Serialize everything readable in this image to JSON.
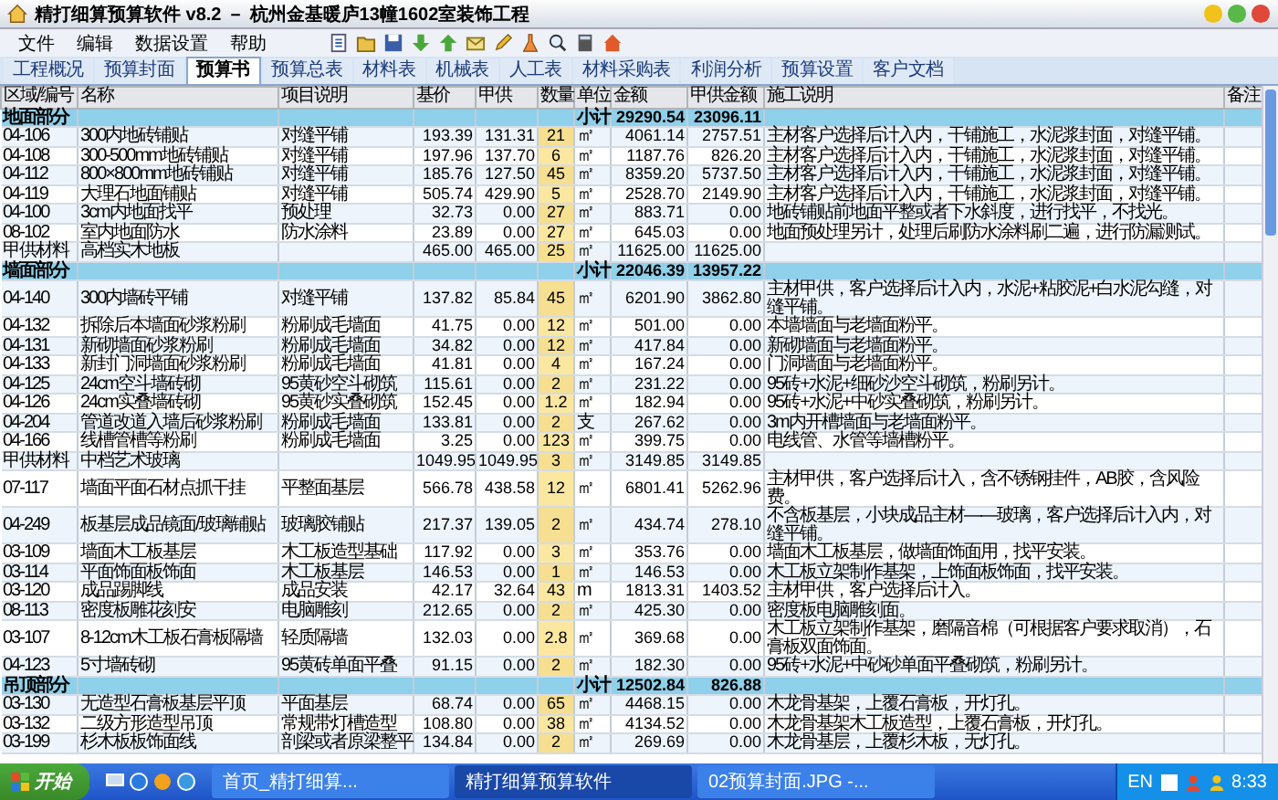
{
  "window": {
    "title": "精打细算预算软件 v8.2 － 杭州金基暖庐13幢1602室装饰工程"
  },
  "menu": [
    "文件",
    "编辑",
    "数据设置",
    "帮助"
  ],
  "tabs": [
    {
      "label": "工程概况",
      "selected": false
    },
    {
      "label": "预算封面",
      "selected": false
    },
    {
      "label": "预算书",
      "selected": true
    },
    {
      "label": "预算总表",
      "selected": false
    },
    {
      "label": "材料表",
      "selected": false
    },
    {
      "label": "机械表",
      "selected": false
    },
    {
      "label": "人工表",
      "selected": false
    },
    {
      "label": "材料采购表",
      "selected": false
    },
    {
      "label": "利润分析",
      "selected": false
    },
    {
      "label": "预算设置",
      "selected": false
    },
    {
      "label": "客户文档",
      "selected": false
    }
  ],
  "table": {
    "columns": [
      "区域/编号",
      "名称",
      "项目说明",
      "基价",
      "甲供",
      "数量",
      "单位",
      "金额",
      "甲供金额",
      "施工说明",
      "备注"
    ],
    "rows": [
      {
        "kind": "section",
        "name": "地面部分",
        "label": "小计",
        "amount": "29290.54",
        "supply_amount": "23096.11"
      },
      {
        "kind": "item",
        "code": "04-106",
        "name": "300内地砖铺贴",
        "spec": "对缝平铺",
        "price": "193.39",
        "supply": "131.31",
        "qty": "21",
        "unit": "㎡",
        "amount": "4061.14",
        "supply_amount": "2757.51",
        "note": "主材客户选择后计入内，干铺施工，水泥浆封面，对缝平铺。"
      },
      {
        "kind": "item",
        "code": "04-108",
        "name": "300-500mm地砖铺贴",
        "spec": "对缝平铺",
        "price": "197.96",
        "supply": "137.70",
        "qty": "6",
        "unit": "㎡",
        "amount": "1187.76",
        "supply_amount": "826.20",
        "note": "主材客户选择后计入内，干铺施工，水泥浆封面，对缝平铺。"
      },
      {
        "kind": "item",
        "code": "04-112",
        "name": "800×800mm地砖铺贴",
        "spec": "对缝平铺",
        "price": "185.76",
        "supply": "127.50",
        "qty": "45",
        "unit": "㎡",
        "amount": "8359.20",
        "supply_amount": "5737.50",
        "note": "主材客户选择后计入内，干铺施工，水泥浆封面，对缝平铺。"
      },
      {
        "kind": "item",
        "code": "04-119",
        "name": "大理石地面铺贴",
        "spec": "对缝平铺",
        "price": "505.74",
        "supply": "429.90",
        "qty": "5",
        "unit": "㎡",
        "amount": "2528.70",
        "supply_amount": "2149.90",
        "note": "主材客户选择后计入内，干铺施工，水泥浆封面，对缝平铺。"
      },
      {
        "kind": "item",
        "code": "04-100",
        "name": "3cm内地面找平",
        "spec": "预处理",
        "price": "32.73",
        "supply": "0.00",
        "qty": "27",
        "unit": "㎡",
        "amount": "883.71",
        "supply_amount": "0.00",
        "note": "地砖铺贴前地面平整或者下水斜度，进行找平，不找光。"
      },
      {
        "kind": "item",
        "code": "08-102",
        "name": "室内地面防水",
        "spec": "防水涂料",
        "price": "23.89",
        "supply": "0.00",
        "qty": "27",
        "unit": "㎡",
        "amount": "645.03",
        "supply_amount": "0.00",
        "note": "地面预处理另计，处理后刷防水涂料刷二遍，进行防漏测试。"
      },
      {
        "kind": "item",
        "code": "甲供材料",
        "name": "高档实木地板",
        "price": "465.00",
        "supply": "465.00",
        "qty": "25",
        "unit": "㎡",
        "amount": "11625.00",
        "supply_amount": "11625.00"
      },
      {
        "kind": "section",
        "name": "墙面部分",
        "label": "小计",
        "amount": "22046.39",
        "supply_amount": "13957.22"
      },
      {
        "kind": "item",
        "code": "04-140",
        "name": "300内墙砖平铺",
        "spec": "对缝平铺",
        "price": "137.82",
        "supply": "85.84",
        "qty": "45",
        "unit": "㎡",
        "amount": "6201.90",
        "supply_amount": "3862.80",
        "note": "主材甲供，客户选择后计入内，水泥+粘胶泥+白水泥勾缝，对缝平铺。"
      },
      {
        "kind": "item",
        "code": "04-132",
        "name": "拆除后本墙面砂浆粉刷",
        "spec": "粉刷成毛墙面",
        "price": "41.75",
        "supply": "0.00",
        "qty": "12",
        "unit": "㎡",
        "amount": "501.00",
        "supply_amount": "0.00",
        "note": "本墙墙面与老墙面粉平。"
      },
      {
        "kind": "item",
        "code": "04-131",
        "name": "新砌墙面砂浆粉刷",
        "spec": "粉刷成毛墙面",
        "price": "34.82",
        "supply": "0.00",
        "qty": "12",
        "unit": "㎡",
        "amount": "417.84",
        "supply_amount": "0.00",
        "note": "新砌墙面与老墙面粉平。"
      },
      {
        "kind": "item",
        "code": "04-133",
        "name": "新封门洞墙面砂浆粉刷",
        "spec": "粉刷成毛墙面",
        "price": "41.81",
        "supply": "0.00",
        "qty": "4",
        "unit": "㎡",
        "amount": "167.24",
        "supply_amount": "0.00",
        "note": "门洞墙面与老墙面粉平。"
      },
      {
        "kind": "item",
        "code": "04-125",
        "name": "24cm空斗墙砖砌",
        "spec": "95黄砂空斗砌筑",
        "price": "115.61",
        "supply": "0.00",
        "qty": "2",
        "unit": "㎡",
        "amount": "231.22",
        "supply_amount": "0.00",
        "note": "95砖+水泥+细砂沙空斗砌筑，粉刷另计。"
      },
      {
        "kind": "item",
        "code": "04-126",
        "name": "24cm实叠墙砖砌",
        "spec": "95黄砂实叠砌筑",
        "price": "152.45",
        "supply": "0.00",
        "qty": "1.2",
        "unit": "㎡",
        "amount": "182.94",
        "supply_amount": "0.00",
        "note": "95砖+水泥+中砂实叠砌筑，粉刷另计。"
      },
      {
        "kind": "item",
        "code": "04-204",
        "name": "管道改道入墙后砂浆粉刷",
        "spec": "粉刷成毛墙面",
        "price": "133.81",
        "supply": "0.00",
        "qty": "2",
        "unit": "支",
        "amount": "267.62",
        "supply_amount": "0.00",
        "note": "3m内开槽墙面与老墙面粉平。"
      },
      {
        "kind": "item",
        "code": "04-166",
        "name": "线槽管槽等粉刷",
        "spec": "粉刷成毛墙面",
        "price": "3.25",
        "supply": "0.00",
        "qty": "123",
        "unit": "㎡",
        "amount": "399.75",
        "supply_amount": "0.00",
        "note": "电线管、水管等墙槽粉平。"
      },
      {
        "kind": "item",
        "code": "甲供材料",
        "name": "中档艺术玻璃",
        "price": "1049.95",
        "supply": "1049.95",
        "qty": "3",
        "unit": "㎡",
        "amount": "3149.85",
        "supply_amount": "3149.85"
      },
      {
        "kind": "item",
        "code": "07-117",
        "name": "墙面平面石材点抓干挂",
        "spec": "平整面基层",
        "price": "566.78",
        "supply": "438.58",
        "qty": "12",
        "unit": "㎡",
        "amount": "6801.41",
        "supply_amount": "5262.96",
        "note": "主材甲供，客户选择后计入，含不锈钢挂件，AB胶，含风险费。"
      },
      {
        "kind": "item",
        "code": "04-249",
        "name": "板基层成品镜面/玻璃铺贴",
        "spec": "玻璃胶铺贴",
        "price": "217.37",
        "supply": "139.05",
        "qty": "2",
        "unit": "㎡",
        "amount": "434.74",
        "supply_amount": "278.10",
        "note": "不含板基层，小块成品主材——玻璃，客户选择后计入内，对缝平铺。"
      },
      {
        "kind": "item",
        "code": "03-109",
        "name": "墙面木工板基层",
        "spec": "木工板造型基础",
        "price": "117.92",
        "supply": "0.00",
        "qty": "3",
        "unit": "㎡",
        "amount": "353.76",
        "supply_amount": "0.00",
        "note": "墙面木工板基层，做墙面饰面用，找平安装。"
      },
      {
        "kind": "item",
        "code": "03-114",
        "name": "平面饰面板饰面",
        "spec": "木工板基层",
        "price": "146.53",
        "supply": "0.00",
        "qty": "1",
        "unit": "㎡",
        "amount": "146.53",
        "supply_amount": "0.00",
        "note": "木工板立架制作基架，上饰面板饰面，找平安装。"
      },
      {
        "kind": "item",
        "code": "03-120",
        "name": "成品踢脚线",
        "spec": "成品安装",
        "price": "42.17",
        "supply": "32.64",
        "qty": "43",
        "unit": "m",
        "amount": "1813.31",
        "supply_amount": "1403.52",
        "note": "主材甲供，客户选择后计入。"
      },
      {
        "kind": "item",
        "code": "08-113",
        "name": "密度板雕花刻安",
        "spec": "电脑雕刻",
        "price": "212.65",
        "supply": "0.00",
        "qty": "2",
        "unit": "㎡",
        "amount": "425.30",
        "supply_amount": "0.00",
        "note": "密度板电脑雕刻面。"
      },
      {
        "kind": "item",
        "code": "03-107",
        "name": "8-12cm木工板石膏板隔墙",
        "spec": "轻质隔墙",
        "price": "132.03",
        "supply": "0.00",
        "qty": "2.8",
        "unit": "㎡",
        "amount": "369.68",
        "supply_amount": "0.00",
        "note": "木工板立架制作基架，磨隔音棉（可根据客户要求取消），石膏板双面饰面。"
      },
      {
        "kind": "item",
        "code": "04-123",
        "name": "5寸墙砖砌",
        "spec": "95黄砖单面平叠",
        "price": "91.15",
        "supply": "0.00",
        "qty": "2",
        "unit": "㎡",
        "amount": "182.30",
        "supply_amount": "0.00",
        "note": "95砖+水泥+中砂砂单面平叠砌筑，粉刷另计。"
      },
      {
        "kind": "section",
        "name": "吊顶部分",
        "label": "小计",
        "amount": "12502.84",
        "supply_amount": "826.88"
      },
      {
        "kind": "item",
        "code": "03-130",
        "name": "无造型石膏板基层平顶",
        "spec": "平面基层",
        "price": "68.74",
        "supply": "0.00",
        "qty": "65",
        "unit": "㎡",
        "amount": "4468.15",
        "supply_amount": "0.00",
        "note": "木龙骨基架，上覆石膏板，开灯孔。"
      },
      {
        "kind": "item",
        "code": "03-132",
        "name": "二级方形造型吊顶",
        "spec": "常规带灯槽造型",
        "price": "108.80",
        "supply": "0.00",
        "qty": "38",
        "unit": "㎡",
        "amount": "4134.52",
        "supply_amount": "0.00",
        "note": "木龙骨基架木工板造型，上覆石膏板，开灯孔。"
      },
      {
        "kind": "item",
        "code": "03-199",
        "name": "杉木板板饰面线",
        "spec": "剖梁或者原梁整平",
        "price": "134.84",
        "supply": "0.00",
        "qty": "2",
        "unit": "㎡",
        "amount": "269.69",
        "supply_amount": "0.00",
        "note": "木龙骨基层，上覆杉木板，无灯孔。"
      }
    ]
  },
  "taskbar": {
    "start": "开始",
    "tasks": [
      {
        "label": "首页_精打细算...",
        "selected": false
      },
      {
        "label": "精打细算预算软件",
        "selected": true
      },
      {
        "label": "02预算封面.JPG -...",
        "selected": false
      }
    ],
    "language": "EN",
    "clock": "8:33"
  }
}
